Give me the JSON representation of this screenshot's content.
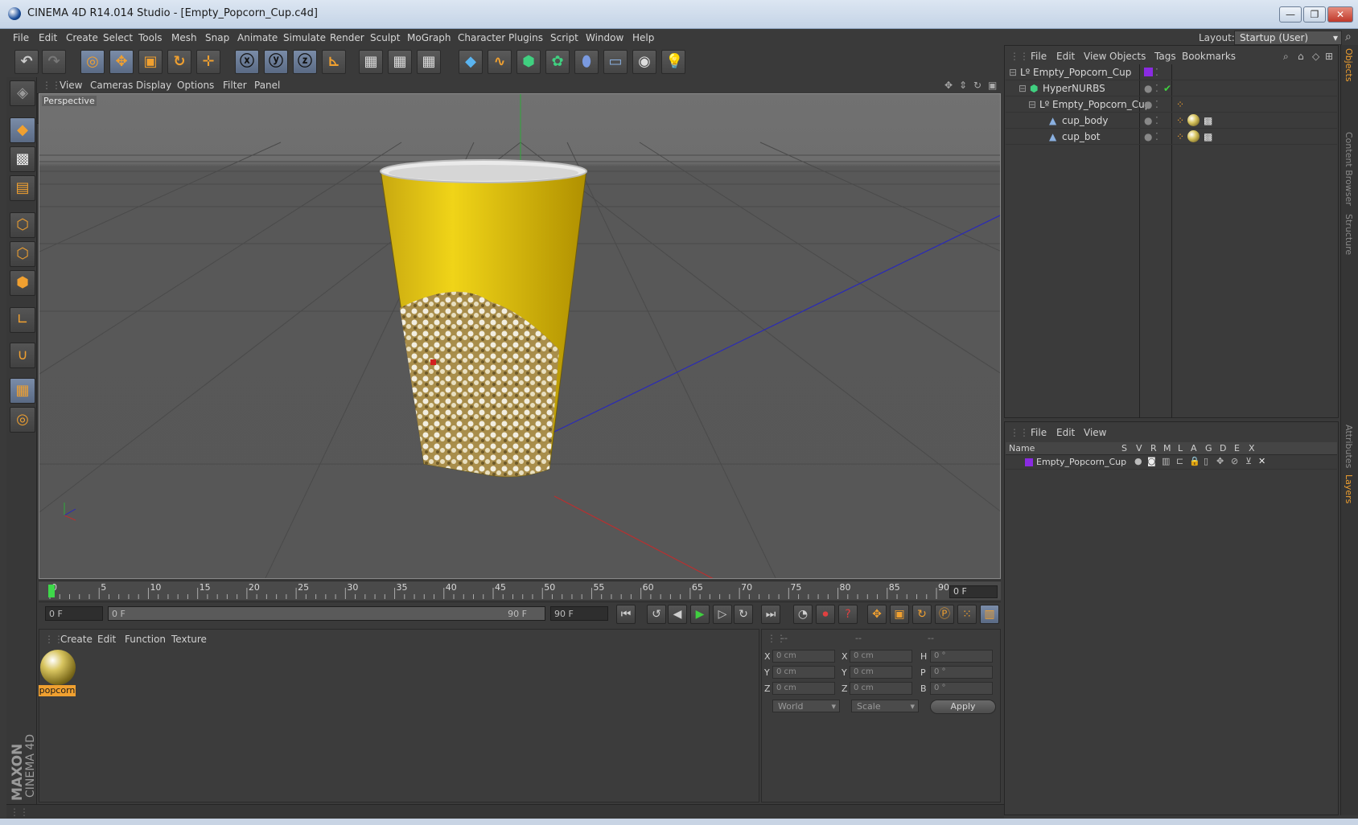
{
  "window": {
    "title": "CINEMA 4D R14.014 Studio - [Empty_Popcorn_Cup.c4d]",
    "min": "—",
    "restore": "❐",
    "close": "✕"
  },
  "menu": [
    "File",
    "Edit",
    "Create",
    "Select",
    "Tools",
    "Mesh",
    "Snap",
    "Animate",
    "Simulate",
    "Render",
    "Sculpt",
    "MoGraph",
    "Character",
    "Plugins",
    "Script",
    "Window",
    "Help"
  ],
  "layout": {
    "label": "Layout:",
    "value": "Startup (User)"
  },
  "viewport": {
    "menu": [
      "View",
      "Cameras",
      "Display",
      "Options",
      "Filter",
      "Panel"
    ],
    "label": "Perspective"
  },
  "timeline": {
    "ticks": [
      "0",
      "5",
      "10",
      "15",
      "20",
      "25",
      "30",
      "35",
      "40",
      "45",
      "50",
      "55",
      "60",
      "65",
      "70",
      "75",
      "80",
      "85",
      "90"
    ],
    "current_frame": "0 F"
  },
  "transport": {
    "start": "0 F",
    "range_start": "0 F",
    "range_end": "90 F",
    "end": "90 F"
  },
  "material_manager": {
    "menu": [
      "Create",
      "Edit",
      "Function",
      "Texture"
    ],
    "material_name": "popcorn"
  },
  "coordinates": {
    "headers": [
      "--",
      "--",
      "--"
    ],
    "rows": [
      {
        "l1": "X",
        "v1": "0 cm",
        "l2": "X",
        "v2": "0 cm",
        "l3": "H",
        "v3": "0 °"
      },
      {
        "l1": "Y",
        "v1": "0 cm",
        "l2": "Y",
        "v2": "0 cm",
        "l3": "P",
        "v3": "0 °"
      },
      {
        "l1": "Z",
        "v1": "0 cm",
        "l2": "Z",
        "v2": "0 cm",
        "l3": "B",
        "v3": "0 °"
      }
    ],
    "mode1": "World",
    "mode2": "Scale",
    "apply": "Apply"
  },
  "object_manager": {
    "menu": [
      "File",
      "Edit",
      "View",
      "Objects",
      "Tags",
      "Bookmarks"
    ],
    "objects": [
      {
        "name": "Empty_Popcorn_Cup"
      },
      {
        "name": "HyperNURBS"
      },
      {
        "name": "Empty_Popcorn_Cup"
      },
      {
        "name": "cup_body"
      },
      {
        "name": "cup_bot"
      }
    ]
  },
  "layer_manager": {
    "menu": [
      "File",
      "Edit",
      "View"
    ],
    "columns": [
      "Name",
      "S",
      "V",
      "R",
      "M",
      "L",
      "A",
      "G",
      "D",
      "E",
      "X"
    ],
    "layer_name": "Empty_Popcorn_Cup"
  },
  "right_tabs": [
    "Objects",
    "Content Browser",
    "Structure",
    "Attributes",
    "Layers"
  ],
  "brand": {
    "maxon": "MAXON",
    "product": "CINEMA 4D"
  },
  "colors": {
    "accent": "#f0a030",
    "layer_color": "#8a2be2",
    "cup_yellow": "#e7c81a"
  }
}
